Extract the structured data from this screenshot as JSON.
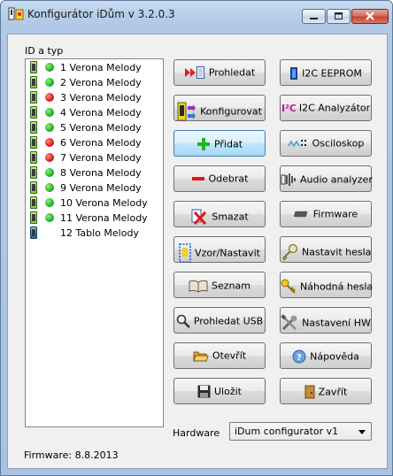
{
  "window": {
    "title": "Konfigurátor iDům v 3.2.0.3"
  },
  "list": {
    "header": "ID a typ",
    "items": [
      {
        "label": "1 Verona Melody",
        "status": "green",
        "device": "verona"
      },
      {
        "label": "2 Verona Melody",
        "status": "green",
        "device": "verona"
      },
      {
        "label": "3 Verona Melody",
        "status": "red",
        "device": "verona"
      },
      {
        "label": "4 Verona Melody",
        "status": "green",
        "device": "verona"
      },
      {
        "label": "5 Verona Melody",
        "status": "green",
        "device": "verona"
      },
      {
        "label": "6 Verona Melody",
        "status": "red",
        "device": "verona"
      },
      {
        "label": "7 Verona Melody",
        "status": "red",
        "device": "verona"
      },
      {
        "label": "8 Verona Melody",
        "status": "green",
        "device": "verona"
      },
      {
        "label": "9 Verona Melody",
        "status": "green",
        "device": "verona"
      },
      {
        "label": "10 Verona Melody",
        "status": "green",
        "device": "verona"
      },
      {
        "label": "11 Verona Melody",
        "status": "green",
        "device": "verona"
      },
      {
        "label": "12 Tablo Melody",
        "status": "",
        "device": "tablo"
      }
    ]
  },
  "buttons": {
    "left": [
      {
        "label": "Prohledat",
        "icon": "search-scan-icon"
      },
      {
        "label": "Konfigurovat",
        "icon": "configure-icon"
      },
      {
        "label": "Přidat",
        "icon": "plus-icon"
      },
      {
        "label": "Odebrat",
        "icon": "minus-icon"
      },
      {
        "label": "Smazat",
        "icon": "delete-icon"
      },
      {
        "label": "Vzor/Nastavit",
        "icon": "template-icon"
      },
      {
        "label": "Seznam",
        "icon": "book-icon"
      },
      {
        "label": "Prohledat USB",
        "icon": "magnifier-icon"
      },
      {
        "label": "Otevřít",
        "icon": "open-folder-icon"
      },
      {
        "label": "Uložit",
        "icon": "save-icon"
      }
    ],
    "right": [
      {
        "label": "I2C EEPROM",
        "icon": "chip-icon"
      },
      {
        "label": "I2C Analyzátor",
        "icon": "i2c-icon"
      },
      {
        "label": "Osciloskop",
        "icon": "oscilloscope-icon"
      },
      {
        "label": "Audio analyzer",
        "icon": "audio-icon"
      },
      {
        "label": "Firmware",
        "icon": "firmware-chip-icon"
      },
      {
        "label": "Nastavit hesla",
        "icon": "key-icon"
      },
      {
        "label": "Náhodná hesla",
        "icon": "random-key-icon"
      },
      {
        "label": "Nastavení HW",
        "icon": "tools-icon"
      },
      {
        "label": "Nápověda",
        "icon": "help-icon"
      },
      {
        "label": "Zavřít",
        "icon": "exit-door-icon"
      }
    ]
  },
  "hardware": {
    "label": "Hardware",
    "value": "iDum configurator v1"
  },
  "status": {
    "firmware": "Firmware: 8.8.2013"
  },
  "colors": {
    "led_green": "#18a518",
    "led_red": "#d01010",
    "focus_border": "#3c7fb1"
  }
}
